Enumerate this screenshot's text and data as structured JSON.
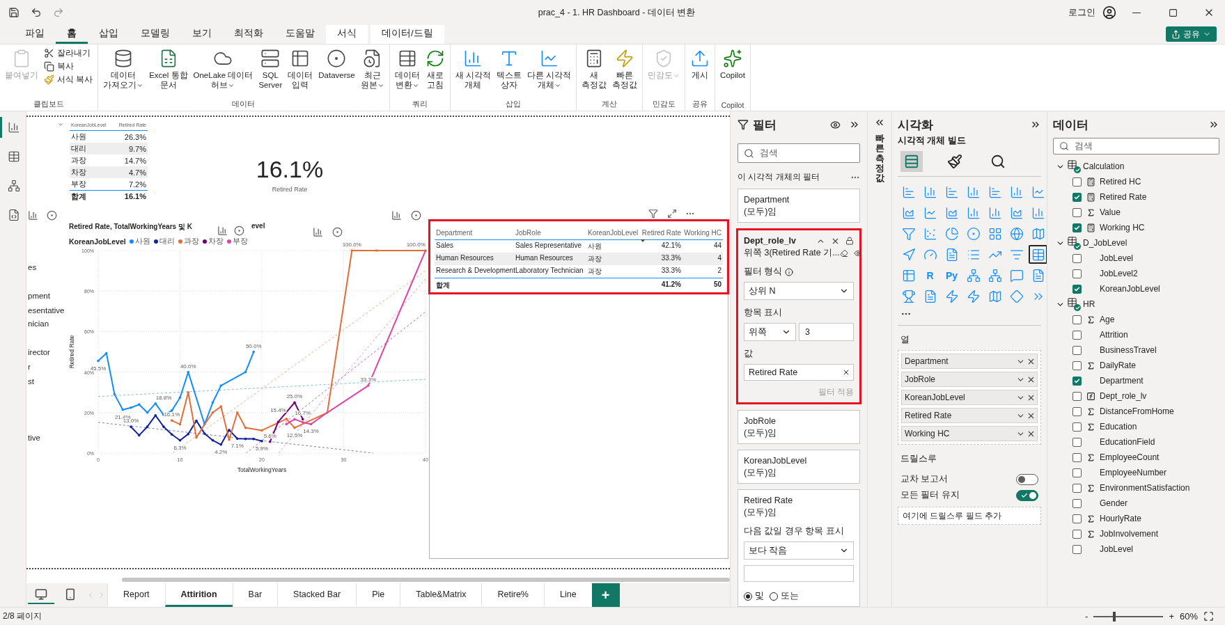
{
  "title_bar": {
    "title": "prac_4 - 1. HR Dashboard - 데이터 변환",
    "login": "로그인"
  },
  "menu_tabs": [
    {
      "label": "파일",
      "selected": false,
      "kind": "normal"
    },
    {
      "label": "홈",
      "selected": true,
      "kind": "normal"
    },
    {
      "label": "삽입",
      "selected": false,
      "kind": "normal"
    },
    {
      "label": "모델링",
      "selected": false,
      "kind": "normal"
    },
    {
      "label": "보기",
      "selected": false,
      "kind": "normal"
    },
    {
      "label": "최적화",
      "selected": false,
      "kind": "normal"
    },
    {
      "label": "도움말",
      "selected": false,
      "kind": "normal"
    },
    {
      "label": "서식",
      "selected": false,
      "kind": "contextual"
    },
    {
      "label": "데이터/드릴",
      "selected": false,
      "kind": "contextual"
    }
  ],
  "share_button": "공유",
  "ribbon_groups": [
    {
      "label": "클립보드",
      "buttons": [
        {
          "label": "붙여넣기",
          "kind": "large",
          "disabled": true,
          "dropdown": false
        },
        {
          "label": "잘라내기",
          "kind": "small",
          "disabled": false,
          "dropdown": false
        },
        {
          "label": "복사",
          "kind": "small",
          "disabled": false,
          "dropdown": false
        },
        {
          "label": "서식 복사",
          "kind": "small",
          "disabled": false,
          "dropdown": false
        }
      ]
    },
    {
      "label": "데이터",
      "buttons": [
        {
          "label": "데이터\n가져오기",
          "disabled": false,
          "dropdown": true
        },
        {
          "label": "Excel 통합\n문서",
          "disabled": false,
          "dropdown": false
        },
        {
          "label": "OneLake 데이터\n허브",
          "disabled": false,
          "dropdown": true
        },
        {
          "label": "SQL\nServer",
          "disabled": false,
          "dropdown": false
        },
        {
          "label": "데이터\n입력",
          "disabled": false,
          "dropdown": false
        },
        {
          "label": "Dataverse",
          "disabled": false,
          "dropdown": false
        },
        {
          "label": "최근\n원본",
          "disabled": false,
          "dropdown": true
        }
      ]
    },
    {
      "label": "쿼리",
      "buttons": [
        {
          "label": "데이터\n변환",
          "disabled": false,
          "dropdown": true
        },
        {
          "label": "새로\n고침",
          "disabled": false,
          "dropdown": false
        }
      ]
    },
    {
      "label": "삽입",
      "buttons": [
        {
          "label": "새 시각적\n개체",
          "disabled": false,
          "dropdown": false
        },
        {
          "label": "텍스트\n상자",
          "disabled": false,
          "dropdown": false
        },
        {
          "label": "다른 시각적\n개체",
          "disabled": false,
          "dropdown": true
        }
      ]
    },
    {
      "label": "계산",
      "buttons": [
        {
          "label": "새\n측정값",
          "disabled": false,
          "dropdown": false
        },
        {
          "label": "빠른\n측정값",
          "disabled": false,
          "dropdown": false
        }
      ]
    },
    {
      "label": "민감도",
      "buttons": [
        {
          "label": "민감도",
          "disabled": true,
          "dropdown": true
        }
      ]
    },
    {
      "label": "공유",
      "buttons": [
        {
          "label": "게시",
          "disabled": false,
          "dropdown": false
        }
      ]
    },
    {
      "label": "Copilot",
      "buttons": [
        {
          "label": "Copilot",
          "disabled": false,
          "dropdown": false
        }
      ]
    }
  ],
  "views": [
    {
      "selected": true
    },
    {
      "selected": false
    },
    {
      "selected": false
    },
    {
      "selected": false
    }
  ],
  "matrix": {
    "columns": [
      "KoreanJobLevel",
      "Retired Rate"
    ],
    "rows": [
      {
        "level": "사원",
        "rate": "26.3%"
      },
      {
        "level": "대리",
        "rate": "9.7%"
      },
      {
        "level": "과장",
        "rate": "14.7%"
      },
      {
        "level": "차장",
        "rate": "4.7%"
      },
      {
        "level": "부장",
        "rate": "7.2%"
      }
    ],
    "total": {
      "label": "합계",
      "value": "16.1%"
    }
  },
  "card": {
    "value": "16.1%",
    "label": "Retired Rate"
  },
  "slicer_fragments": [
    "es",
    "pment",
    "esentative",
    "nician",
    "irector",
    "r",
    "st",
    "tive"
  ],
  "line_visual": {
    "title_rest": "evel",
    "legend_title": "KoreanJobLevel",
    "chart_data": {
      "type": "line",
      "grid": true,
      "legend": true,
      "title": "Retired Rate, TotalWorkingYears 및 K",
      "xlabel": "TotalWorkingYears",
      "ylabel": "Retired Rate",
      "xlim": [
        0,
        40
      ],
      "ylim": [
        0,
        100
      ],
      "xticks": [
        0,
        10,
        20,
        30,
        40
      ],
      "yticks": [
        {
          "value": 0,
          "label": "0%"
        },
        {
          "value": 20,
          "label": "20%"
        },
        {
          "value": 40,
          "label": "40%"
        },
        {
          "value": 60,
          "label": "60%"
        },
        {
          "value": 80,
          "label": "80%"
        },
        {
          "value": 100,
          "label": "100%"
        }
      ],
      "x": [
        0,
        1,
        2,
        3,
        4,
        5,
        6,
        7,
        8,
        9,
        10,
        11,
        12,
        13,
        14,
        15,
        16,
        17,
        18,
        19,
        20,
        21,
        22,
        23,
        24,
        25,
        26,
        27,
        28,
        29,
        30,
        31,
        32,
        33,
        34,
        35,
        36,
        37,
        38,
        39,
        40
      ],
      "series": [
        {
          "name": "사원",
          "color": "#118dff",
          "values": [
            45.5,
            49.3,
            29,
            21.4,
            22.4,
            24,
            20,
            24.5,
            18.8,
            21,
            27.4,
            40,
            null,
            14.2,
            25,
            33.3,
            null,
            null,
            40,
            50,
            null,
            null,
            null,
            null,
            null,
            null,
            null,
            null,
            null,
            null,
            null,
            null,
            null,
            null,
            null,
            null,
            null,
            null,
            null,
            null,
            null
          ]
        },
        {
          "name": "대리",
          "color": "#12239e",
          "values": [
            null,
            null,
            null,
            null,
            13,
            8.8,
            13,
            18.6,
            13,
            9.2,
            6.3,
            9.4,
            16,
            9.6,
            6.3,
            4.2,
            11.4,
            7.1,
            7,
            7,
            5.9,
            null,
            null,
            null,
            null,
            null,
            null,
            null,
            null,
            null,
            null,
            null,
            null,
            null,
            null,
            null,
            null,
            null,
            null,
            null,
            null
          ]
        },
        {
          "name": "과장",
          "color": "#e66c37",
          "values": [
            null,
            null,
            null,
            null,
            null,
            null,
            null,
            null,
            null,
            16.1,
            14.2,
            30,
            7.7,
            14.2,
            20,
            23,
            6.6,
            20,
            12.5,
            null,
            11.2,
            null,
            null,
            16.9,
            12.5,
            null,
            null,
            null,
            20,
            null,
            null,
            100,
            null,
            null,
            100,
            null,
            null,
            null,
            null,
            null,
            100
          ]
        },
        {
          "name": "차장",
          "color": "#6b007b",
          "values": [
            null,
            null,
            null,
            null,
            null,
            null,
            null,
            null,
            null,
            null,
            null,
            null,
            null,
            null,
            null,
            null,
            null,
            null,
            null,
            null,
            null,
            5.6,
            15.4,
            null,
            25,
            16.7,
            null,
            null,
            null,
            null,
            null,
            null,
            null,
            null,
            null,
            null,
            null,
            null,
            null,
            null,
            null
          ]
        },
        {
          "name": "부장",
          "color": "#e044a7",
          "values": [
            null,
            null,
            null,
            null,
            null,
            null,
            null,
            null,
            null,
            null,
            null,
            null,
            null,
            null,
            null,
            null,
            null,
            null,
            null,
            null,
            null,
            null,
            null,
            14.3,
            16.7,
            15.2,
            14.3,
            null,
            20,
            null,
            null,
            null,
            null,
            33.3,
            null,
            null,
            null,
            null,
            null,
            null,
            100
          ]
        }
      ],
      "annotations": [
        {
          "x": 0,
          "y": 45.5,
          "text": "45.5%"
        },
        {
          "x": 3,
          "y": 21.4,
          "text": "21.4%"
        },
        {
          "x": 8,
          "y": 18.8,
          "text": "18.8%"
        },
        {
          "x": 11,
          "y": 40,
          "text": "40.0%"
        },
        {
          "x": 19,
          "y": 50,
          "text": "50.0%"
        },
        {
          "x": 4,
          "y": 13,
          "text": "13.0%"
        },
        {
          "x": 9,
          "y": 16.1,
          "text": "16.1%"
        },
        {
          "x": 10,
          "y": 6.3,
          "text": "6.3%"
        },
        {
          "x": 15,
          "y": 4.2,
          "text": "4.2%"
        },
        {
          "x": 17,
          "y": 7.1,
          "text": "7.1%"
        },
        {
          "x": 20,
          "y": 5.9,
          "text": "5.9%"
        },
        {
          "x": 21,
          "y": 5.6,
          "text": "5.6%"
        },
        {
          "x": 22,
          "y": 15.4,
          "text": "15.4%"
        },
        {
          "x": 24,
          "y": 25,
          "text": "25.0%"
        },
        {
          "x": 24,
          "y": 12.5,
          "text": "12.5%"
        },
        {
          "x": 25,
          "y": 16.7,
          "text": "16.7%"
        },
        {
          "x": 26,
          "y": 14.3,
          "text": "14.3%"
        },
        {
          "x": 33,
          "y": 33.3,
          "text": "33.3%"
        },
        {
          "x": 31,
          "y": 100,
          "text": "100.0%"
        },
        {
          "x": 40,
          "y": 100,
          "text": "100.0%"
        }
      ]
    }
  },
  "table_visual": {
    "highlighted": true,
    "columns": [
      {
        "label": "Department",
        "sorted": false
      },
      {
        "label": "JobRole",
        "sorted": false
      },
      {
        "label": "KoreanJobLevel",
        "sorted": false
      },
      {
        "label": "Retired Rate",
        "sorted": true
      },
      {
        "label": "Working HC",
        "sorted": false
      }
    ],
    "rows": [
      [
        "Sales",
        "Sales Representative",
        "사원",
        "42.1%",
        "44"
      ],
      [
        "Human Resources",
        "Human Resources",
        "과장",
        "33.3%",
        "4"
      ],
      [
        "Research & Development",
        "Laboratory Technician",
        "과장",
        "33.3%",
        "2"
      ]
    ],
    "total": {
      "label": "합계",
      "values": [
        "41.2%",
        "50"
      ]
    }
  },
  "filter_pane": {
    "title": "필터",
    "search_placeholder": "검색",
    "section": "이 시각적 개체의 필터",
    "cards": [
      {
        "field": "Department",
        "summary": "(모두)임",
        "kind": "basic",
        "expanded": false,
        "highlighted": false
      },
      {
        "field": "Dept_role_lv",
        "summary": "위쪽 3(Retired Rate 기...",
        "kind": "topn",
        "expanded": true,
        "highlighted": true,
        "filter_type_label": "필터 형식",
        "filter_type": "상위 N",
        "show_items_label": "항목 표시",
        "direction": "위쪽",
        "count": "3",
        "value_label": "값",
        "value": "Retired Rate",
        "apply": {
          "label": "필터 적용",
          "disabled": true
        }
      },
      {
        "field": "JobRole",
        "summary": "(모두)임",
        "kind": "basic",
        "expanded": false,
        "highlighted": false
      },
      {
        "field": "KoreanJobLevel",
        "summary": "(모두)임",
        "kind": "basic",
        "expanded": false,
        "highlighted": false
      },
      {
        "field": "Retired Rate",
        "summary": "(모두)임",
        "kind": "advanced",
        "expanded": true,
        "highlighted": false,
        "condition_label": "다음 값일 경우 항목 표시",
        "condition": "보다 작음",
        "logic": [
          {
            "label": "및",
            "selected": true
          },
          {
            "label": "또는",
            "selected": false
          }
        ]
      }
    ]
  },
  "quick_measure": "빠른 측정값",
  "viz_pane": {
    "title": "시각화",
    "subtitle": "시각적 개체 빌드",
    "tabs": [
      {
        "selected": true
      },
      {
        "selected": false
      },
      {
        "selected": false
      }
    ],
    "types": [
      {
        "selected": false
      },
      {
        "selected": false
      },
      {
        "selected": false
      },
      {
        "selected": false
      },
      {
        "selected": false
      },
      {
        "selected": false
      },
      {
        "selected": false
      },
      {
        "selected": false
      },
      {
        "selected": false
      },
      {
        "selected": false
      },
      {
        "selected": false
      },
      {
        "selected": false
      },
      {
        "selected": false
      },
      {
        "selected": false
      },
      {
        "selected": false
      },
      {
        "selected": false
      },
      {
        "selected": false
      },
      {
        "selected": false
      },
      {
        "selected": false
      },
      {
        "selected": false
      },
      {
        "selected": false
      },
      {
        "selected": false
      },
      {
        "selected": false
      },
      {
        "selected": false
      },
      {
        "selected": false
      },
      {
        "selected": false
      },
      {
        "selected": false
      },
      {
        "selected": true
      },
      {
        "selected": false
      },
      {
        "selected": false,
        "label": "R"
      },
      {
        "selected": false,
        "label": "Py"
      },
      {
        "selected": false
      },
      {
        "selected": false
      },
      {
        "selected": false
      },
      {
        "selected": false
      },
      {
        "selected": false
      },
      {
        "selected": false
      },
      {
        "selected": false
      },
      {
        "selected": false
      },
      {
        "selected": false
      },
      {
        "selected": false
      },
      {
        "selected": false
      }
    ],
    "columns_label": "열",
    "fields": [
      "Department",
      "JobRole",
      "KoreanJobLevel",
      "Retired Rate",
      "Working HC"
    ],
    "drill_label": "드릴스루",
    "toggles": [
      {
        "label": "교차 보고서",
        "on": false
      },
      {
        "label": "모든 필터 유지",
        "on": true
      }
    ],
    "drill_placeholder": "여기에 드릴스루 필드 추가"
  },
  "data_pane": {
    "title": "데이터",
    "search_placeholder": "검색",
    "tables": [
      {
        "name": "Calculation",
        "expanded": true,
        "fields": [
          {
            "name": "Retired HC",
            "checked": false,
            "kind": "measure"
          },
          {
            "name": "Retired Rate",
            "checked": true,
            "kind": "measure"
          },
          {
            "name": "Value",
            "checked": false,
            "kind": "sum"
          },
          {
            "name": "Working HC",
            "checked": true,
            "kind": "measure"
          }
        ]
      },
      {
        "name": "D_JobLevel",
        "expanded": true,
        "fields": [
          {
            "name": "JobLevel",
            "checked": false,
            "kind": "plain"
          },
          {
            "name": "JobLevel2",
            "checked": false,
            "kind": "plain"
          },
          {
            "name": "KoreanJobLevel",
            "checked": true,
            "kind": "plain"
          }
        ]
      },
      {
        "name": "HR",
        "expanded": true,
        "fields": [
          {
            "name": "Age",
            "checked": false,
            "kind": "sum"
          },
          {
            "name": "Attrition",
            "checked": false,
            "kind": "plain"
          },
          {
            "name": "BusinessTravel",
            "checked": false,
            "kind": "plain"
          },
          {
            "name": "DailyRate",
            "checked": false,
            "kind": "sum"
          },
          {
            "name": "Department",
            "checked": true,
            "kind": "plain"
          },
          {
            "name": "Dept_role_lv",
            "checked": false,
            "kind": "calc"
          },
          {
            "name": "DistanceFromHome",
            "checked": false,
            "kind": "sum"
          },
          {
            "name": "Education",
            "checked": false,
            "kind": "sum"
          },
          {
            "name": "EducationField",
            "checked": false,
            "kind": "plain"
          },
          {
            "name": "EmployeeCount",
            "checked": false,
            "kind": "sum"
          },
          {
            "name": "EmployeeNumber",
            "checked": false,
            "kind": "plain"
          },
          {
            "name": "EnvironmentSatisfaction",
            "checked": false,
            "kind": "sum"
          },
          {
            "name": "Gender",
            "checked": false,
            "kind": "plain"
          },
          {
            "name": "HourlyRate",
            "checked": false,
            "kind": "sum"
          },
          {
            "name": "JobInvolvement",
            "checked": false,
            "kind": "sum"
          },
          {
            "name": "JobLevel",
            "checked": false,
            "kind": "plain"
          }
        ]
      }
    ]
  },
  "page_tabs": [
    {
      "label": "Report",
      "selected": false
    },
    {
      "label": "Attirition",
      "selected": true
    },
    {
      "label": "Bar",
      "selected": false
    },
    {
      "label": "Stacked Bar",
      "selected": false
    },
    {
      "label": "Pie",
      "selected": false
    },
    {
      "label": "Table&Matrix",
      "selected": false
    },
    {
      "label": "Retire%",
      "selected": false
    },
    {
      "label": "Line",
      "selected": false
    }
  ],
  "add_page": "+",
  "device_views": [
    {
      "selected": true
    },
    {
      "selected": false
    }
  ],
  "status_bar": {
    "page": "2/8 페이지",
    "zoom_out": "-",
    "zoom_in": "+",
    "zoom": {
      "level": 0.3,
      "reading": "60%"
    }
  }
}
